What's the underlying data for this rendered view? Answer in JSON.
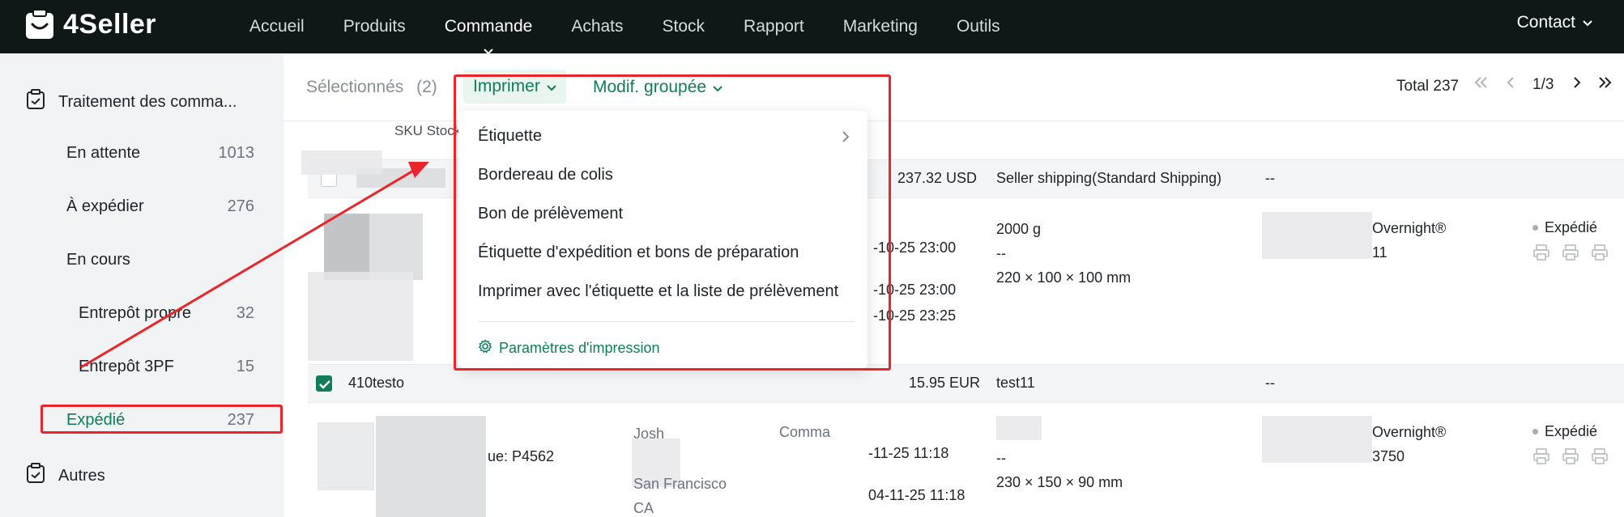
{
  "app": {
    "logo_text": "4Seller"
  },
  "nav": {
    "items": [
      "Accueil",
      "Produits",
      "Commande",
      "Achats",
      "Stock",
      "Rapport",
      "Marketing",
      "Outils"
    ],
    "contact": "Contact"
  },
  "sidebar": {
    "group1": "Traitement des comma...",
    "group2": "Autres",
    "items": [
      {
        "label": "En attente",
        "count": "1013"
      },
      {
        "label": "À expédier",
        "count": "276"
      },
      {
        "label": "En cours",
        "count": ""
      },
      {
        "label": "Entrepôt propre",
        "count": "32"
      },
      {
        "label": "Entrepôt 3PF",
        "count": "15"
      },
      {
        "label": "Expédié",
        "count": "237"
      }
    ]
  },
  "toolbar": {
    "selected_label": "Sélectionnés",
    "selected_count": "(2)",
    "print_label": "Imprimer",
    "batch_label": "Modif. groupée",
    "total": "Total 237",
    "page": "1/3"
  },
  "table": {
    "col_sku": "SKU Stock",
    "row1": {
      "amount": "237.32 USD",
      "shipping": "Seller shipping(Standard Shipping)",
      "dash": "--",
      "date1": "-10-25 23:00",
      "date2": "-10-25 23:00",
      "date3": "-10-25 23:25",
      "weight": "2000 g",
      "weight_dash": "--",
      "dims": "220 × 100 × 100 mm",
      "carrier": "Overnight®",
      "tracking": "11",
      "status": "Expédié"
    },
    "row2": {
      "order_id": "410testo",
      "amount": "15.95 EUR",
      "shipping": "test11",
      "dash": "--",
      "product_ref": "ue: P4562",
      "buyer": "Josh",
      "city": "San Francisco",
      "state": "CA",
      "comm": "Comma",
      "date1": "-11-25 11:18",
      "date2": "04-11-25 11:18",
      "weight_dash": "--",
      "dims": "230 × 150 × 90 mm",
      "carrier": "Overnight®",
      "tracking": "3750",
      "status": "Expédié"
    }
  },
  "print_menu": {
    "items": [
      "Étiquette",
      "Bordereau de colis",
      "Bon de prélèvement",
      "Étiquette d'expédition et bons de préparation",
      "Imprimer avec l'étiquette et la liste de prélèvement"
    ],
    "settings": "Paramètres d'impression"
  },
  "colors": {
    "accent": "#0f7d5b",
    "nav_bg": "#0f1816",
    "annotation": "#e8262b"
  }
}
